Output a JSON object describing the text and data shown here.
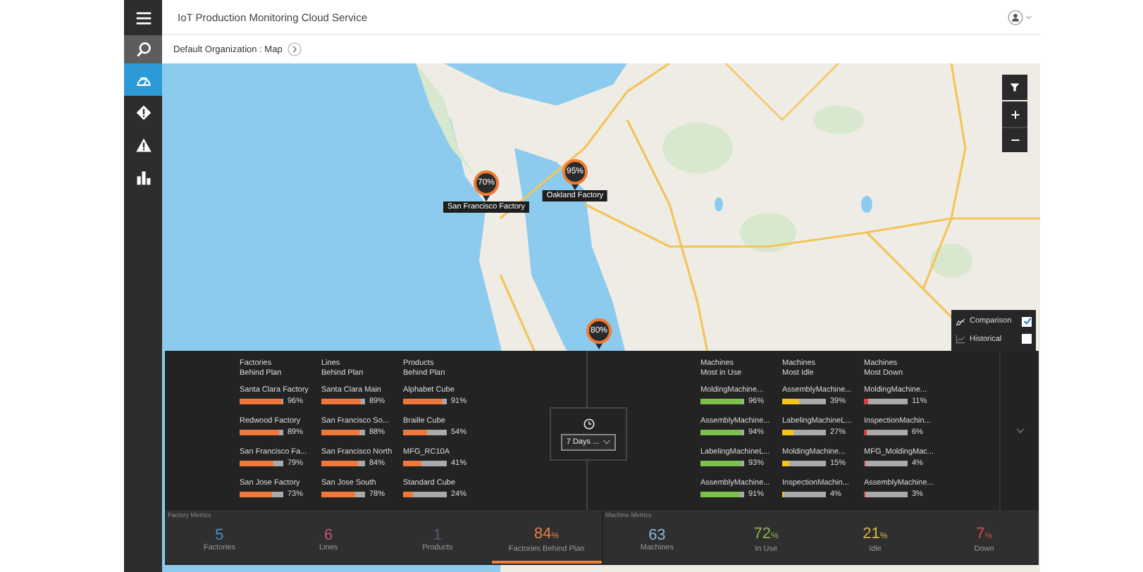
{
  "header": {
    "title": "IoT Production Monitoring Cloud Service"
  },
  "breadcrumb": {
    "text": "Default Organization : Map"
  },
  "sidebar": {
    "items": [
      {
        "kind": "menu",
        "selected": false
      },
      {
        "kind": "search",
        "selected": false
      },
      {
        "kind": "map",
        "selected": true
      },
      {
        "kind": "alert",
        "selected": false
      },
      {
        "kind": "warning",
        "selected": false
      },
      {
        "kind": "chart",
        "selected": false
      }
    ]
  },
  "map": {
    "markers": [
      {
        "reading": "70%",
        "label": "San Francisco Factory"
      },
      {
        "reading": "95%",
        "label": "Oakland Factory"
      },
      {
        "reading": "80%"
      }
    ]
  },
  "legend": [
    {
      "kind": "comparison",
      "label": "Comparison",
      "checked": true
    },
    {
      "kind": "historical",
      "label": "Historical",
      "checked": false
    }
  ],
  "panel": {
    "period": "7 Days ...",
    "groups": [
      {
        "title": "Factories\nBehind Plan",
        "color": "#f0783c",
        "rows": [
          {
            "name": "Santa Clara Factory",
            "level": 0.96,
            "reading": "96%"
          },
          {
            "name": "Redwood Factory",
            "level": 0.89,
            "reading": "89%"
          },
          {
            "name": "San Francisco Fa...",
            "level": 0.79,
            "reading": "79%"
          },
          {
            "name": "San Jose Factory",
            "level": 0.73,
            "reading": "73%"
          }
        ]
      },
      {
        "title": "Lines\nBehind Plan",
        "color": "#f0783c",
        "rows": [
          {
            "name": "Santa Clara Main",
            "level": 0.89,
            "reading": "89%"
          },
          {
            "name": "San Francisco So...",
            "level": 0.88,
            "reading": "88%"
          },
          {
            "name": "San Francisco North",
            "level": 0.84,
            "reading": "84%"
          },
          {
            "name": "San Jose South",
            "level": 0.78,
            "reading": "78%"
          }
        ]
      },
      {
        "title": "Products\nBehind Plan",
        "color": "#f0783c",
        "rows": [
          {
            "name": "Alphabet Cube",
            "level": 0.91,
            "reading": "91%"
          },
          {
            "name": "Braille Cube",
            "level": 0.54,
            "reading": "54%"
          },
          {
            "name": "MFG_RC10A",
            "level": 0.41,
            "reading": "41%"
          },
          {
            "name": "Standard Cube",
            "level": 0.24,
            "reading": "24%"
          }
        ]
      },
      {
        "title": "Machines\nMost in Use",
        "color": "#7cc04e",
        "rows": [
          {
            "name": "MoldingMachine...",
            "level": 0.96,
            "reading": "96%"
          },
          {
            "name": "AssemblyMachine...",
            "level": 0.94,
            "reading": "94%"
          },
          {
            "name": "LabelingMachineL...",
            "level": 0.93,
            "reading": "93%"
          },
          {
            "name": "AssemblyMachine...",
            "level": 0.91,
            "reading": "91%"
          }
        ]
      },
      {
        "title": "Machines\nMost Idle",
        "color": "#f5c518",
        "rows": [
          {
            "name": "AssemblyMachine...",
            "level": 0.39,
            "reading": "39%"
          },
          {
            "name": "LabelingMachineL...",
            "level": 0.27,
            "reading": "27%"
          },
          {
            "name": "MoldingMachine...",
            "level": 0.15,
            "reading": "15%"
          },
          {
            "name": "InspectionMachin...",
            "level": 0.04,
            "reading": "4%"
          }
        ]
      },
      {
        "title": "Machines\nMost Down",
        "color": "#e0393e",
        "rows": [
          {
            "name": "MoldingMachine...",
            "level": 0.11,
            "reading": "11%"
          },
          {
            "name": "InspectionMachin...",
            "level": 0.06,
            "reading": "6%"
          },
          {
            "name": "MFG_MoldingMac...",
            "level": 0.04,
            "reading": "4%"
          },
          {
            "name": "AssemblyMachine...",
            "level": 0.03,
            "reading": "3%"
          }
        ]
      }
    ]
  },
  "metrics": [
    {
      "title": "Factory Metrics",
      "items": [
        {
          "value": "5",
          "label": "Factories",
          "color": "#4a8fc9",
          "selected": false
        },
        {
          "value": "6",
          "label": "Lines",
          "color": "#c4587c",
          "selected": false
        },
        {
          "value": "1",
          "label": "Products",
          "color": "#4a5a72",
          "selected": false
        },
        {
          "value": "84",
          "unit": "%",
          "label": "Factories Behind Plan",
          "color": "#e8803f",
          "selected": true
        }
      ]
    },
    {
      "title": "Machine Metrics",
      "items": [
        {
          "value": "63",
          "label": "Machines",
          "color": "#8db6d6",
          "selected": false
        },
        {
          "value": "72",
          "unit": "%",
          "label": "In Use",
          "color": "#8cb84a",
          "selected": false
        },
        {
          "value": "21",
          "unit": "%",
          "label": "Idle",
          "color": "#d8b24a",
          "selected": false
        },
        {
          "value": "7",
          "unit": "%",
          "label": "Down",
          "color": "#d24a4a",
          "selected": false
        }
      ]
    }
  ]
}
